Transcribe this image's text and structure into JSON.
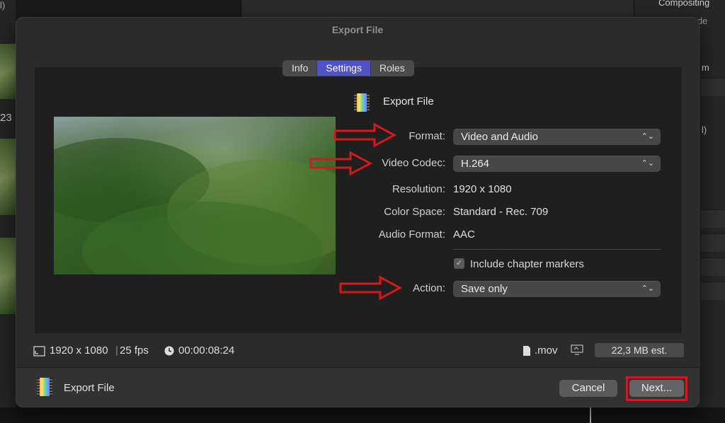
{
  "background": {
    "right_panel_items": [
      "Compositing",
      "Blend Mode",
      "m",
      "l)"
    ],
    "left_number": "23",
    "left_top_text": "l)"
  },
  "dialog": {
    "title": "Export File",
    "tabs": [
      {
        "label": "Info",
        "active": false
      },
      {
        "label": "Settings",
        "active": true
      },
      {
        "label": "Roles",
        "active": false
      }
    ],
    "heading": "Export File",
    "settings": {
      "format": {
        "label": "Format:",
        "value": "Video and Audio"
      },
      "video_codec": {
        "label": "Video Codec:",
        "value": "H.264"
      },
      "resolution": {
        "label": "Resolution:",
        "value": "1920 x 1080"
      },
      "color_space": {
        "label": "Color Space:",
        "value": "Standard - Rec. 709"
      },
      "audio_format": {
        "label": "Audio Format:",
        "value": "AAC"
      },
      "chapter_markers": {
        "label": "Include chapter markers",
        "checked": true
      },
      "action": {
        "label": "Action:",
        "value": "Save only"
      }
    },
    "info_bar": {
      "resolution": "1920 x 1080",
      "fps": "25 fps",
      "duration": "00:00:08:24",
      "file_ext": ".mov",
      "size_estimate": "22,3 MB est."
    },
    "footer": {
      "title": "Export File",
      "cancel_label": "Cancel",
      "next_label": "Next..."
    }
  },
  "colors": {
    "accent_tab": "#4f53c7",
    "annotation_red": "#d11a1a"
  }
}
